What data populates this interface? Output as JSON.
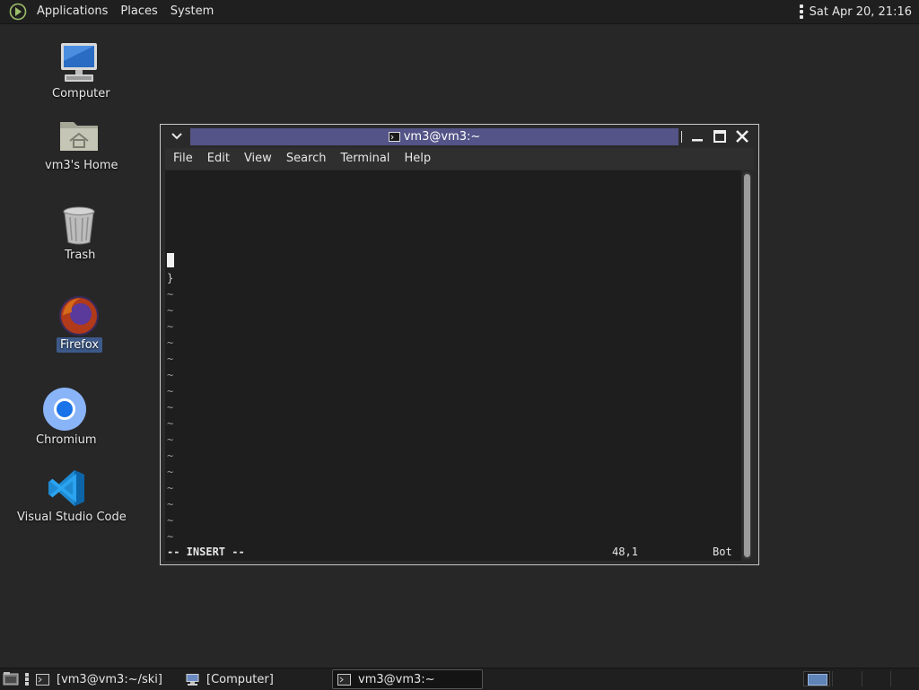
{
  "top_panel": {
    "menus": [
      "Applications",
      "Places",
      "System"
    ],
    "clock": "Sat Apr 20, 21:16"
  },
  "desktop": {
    "icons": [
      {
        "label": "Computer",
        "icon": "computer-icon",
        "selected": false
      },
      {
        "label": "vm3's Home",
        "icon": "home-folder-icon",
        "selected": false
      },
      {
        "label": "Trash",
        "icon": "trash-icon",
        "selected": false
      },
      {
        "label": "Firefox",
        "icon": "firefox-icon",
        "selected": true
      },
      {
        "label": "Chromium",
        "icon": "chromium-icon",
        "selected": false
      },
      {
        "label": "Visual Studio Code",
        "icon": "vscode-icon",
        "selected": false
      }
    ]
  },
  "terminal": {
    "title": "vm3@vm3:~",
    "menu": [
      "File",
      "Edit",
      "View",
      "Search",
      "Terminal",
      "Help"
    ],
    "content": {
      "brace_line": "}",
      "tilde": "~",
      "mode": "-- INSERT --",
      "position": "48,1",
      "scroll": "Bot"
    }
  },
  "taskbar": {
    "tasks": [
      {
        "label": "[vm3@vm3:~/ski]",
        "active": false,
        "icon": "terminal-icon"
      },
      {
        "label": "[Computer]",
        "active": false,
        "icon": "computer-icon"
      },
      {
        "label": "vm3@vm3:~",
        "active": true,
        "icon": "terminal-icon"
      }
    ]
  },
  "colors": {
    "desktop_bg": "#272727",
    "panel_bg": "#1f1f1f",
    "title_active": "#545488",
    "selection": "#3d5a8a"
  }
}
